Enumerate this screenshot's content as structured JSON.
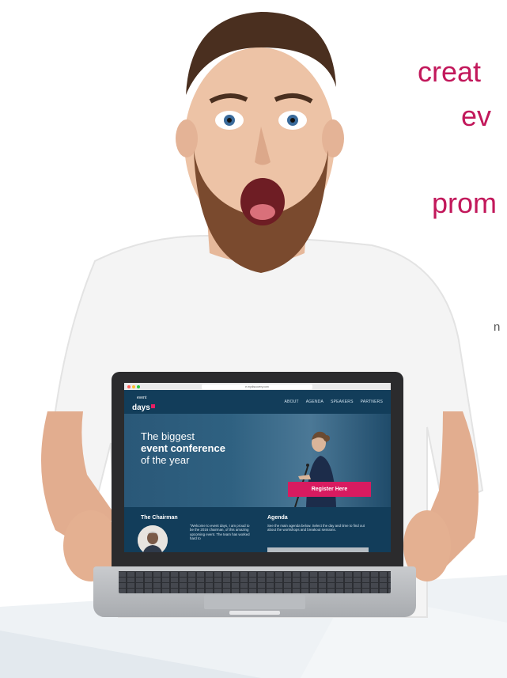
{
  "headline": {
    "line1": "creat",
    "line2": "ev",
    "line3": "prom",
    "side_note": "n"
  },
  "browser": {
    "url": "e.mydiscovery.com"
  },
  "site": {
    "logo_small": "event",
    "logo_main": "days",
    "nav": [
      "ABOUT",
      "AGENDA",
      "SPEAKERS",
      "PARTNERS"
    ],
    "hero": {
      "line1": "The biggest",
      "line2": "event conference",
      "line3": "of the year"
    },
    "register_label": "Register Here",
    "chairman": {
      "title": "The Chairman",
      "quote": "\"Welcome to event days, I am proud to be the 2016 chairman, of this amazing upcoming event. The team has worked hard to"
    },
    "agenda": {
      "title": "Agenda",
      "text": "See the main agenda below. Select the day and time to find out about the workshops and breakout sessions."
    }
  },
  "colors": {
    "brand": "#c2185b",
    "site_navy": "#123d5a",
    "cta": "#d81b60"
  }
}
